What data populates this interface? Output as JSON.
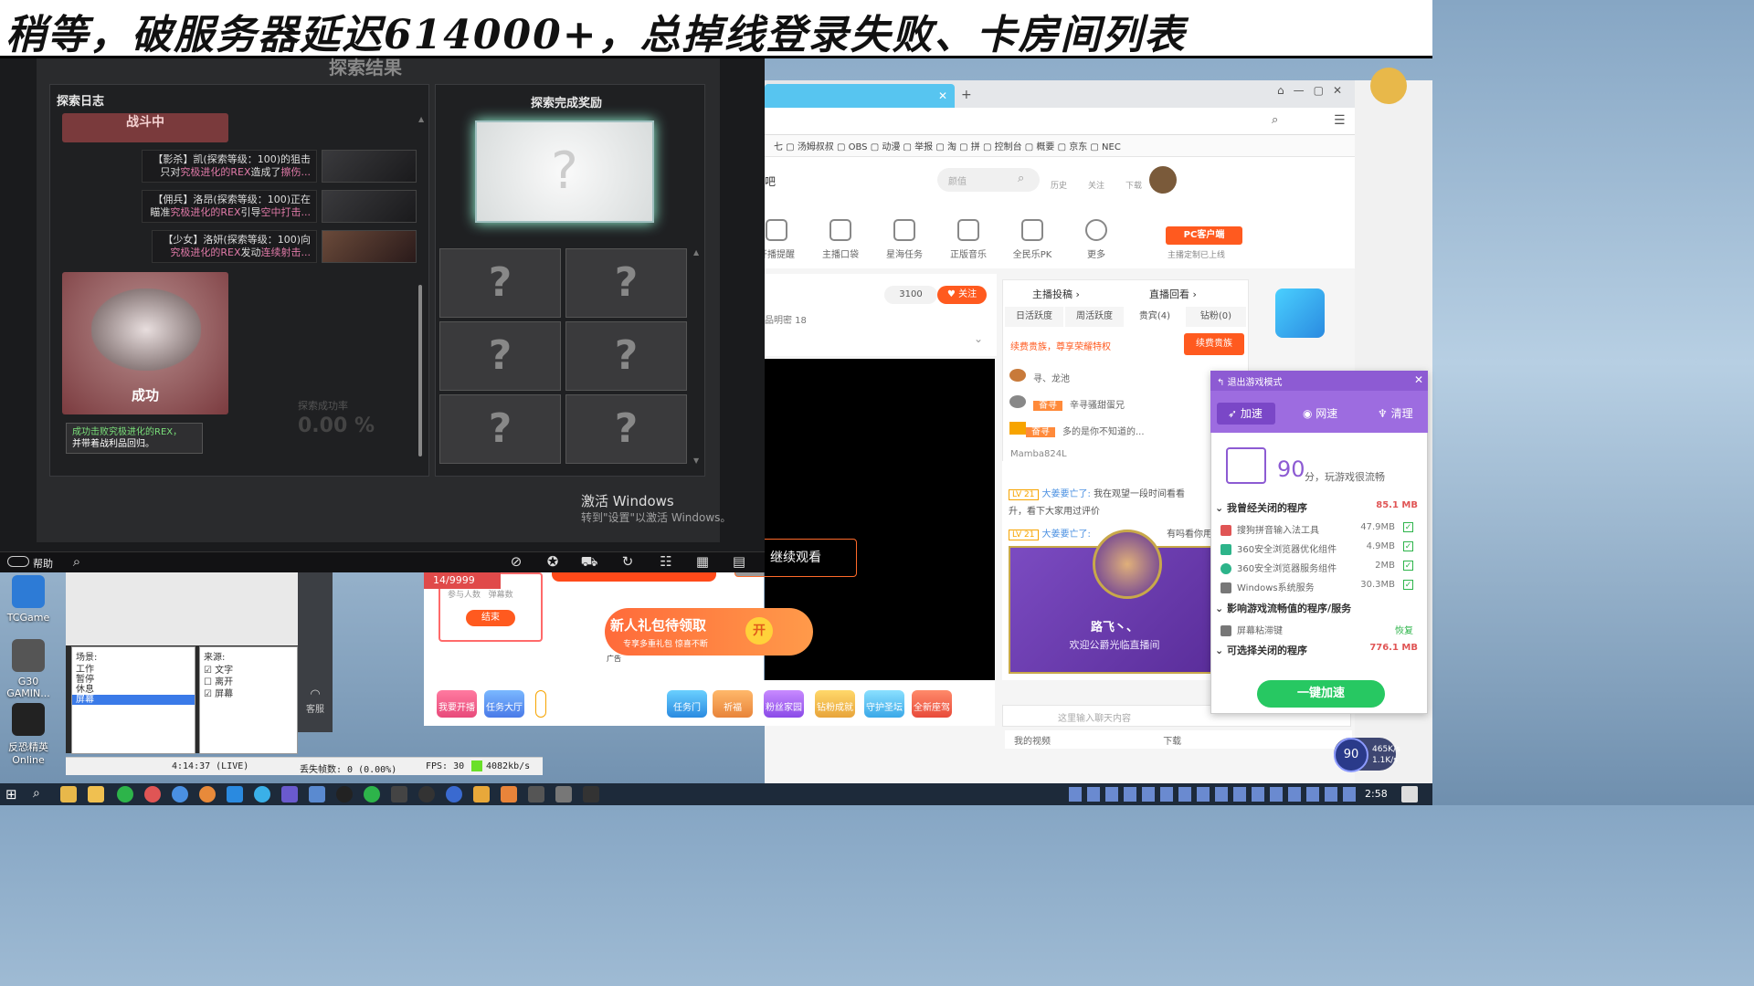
{
  "banner": {
    "text": "稍等，破服务器延迟614000+，总掉线登录失败、卡房间列表"
  },
  "desktop_icons": [
    {
      "label": "TCGame",
      "color": "#2d7bd6"
    },
    {
      "label": "G30 GAMIN...",
      "color": "#555"
    },
    {
      "label": "反恐精英 Online",
      "color": "#222"
    }
  ],
  "game": {
    "title": "探索结果",
    "log_title": "探索日志",
    "combat": "战斗中",
    "entries": [
      {
        "text1": "【影杀】凯(探索等级：100)的狙击",
        "text2": "只对",
        "hl": "究极进化的REX",
        "text3": "造成了",
        "hl2": "擦伤..."
      },
      {
        "text1": "【佣兵】洛昂(探索等级：100)正在",
        "text2": "瞄准",
        "hl": "究极进化的REX",
        "text3": "引导",
        "hl2": "空中打击..."
      },
      {
        "text1": "【少女】洛妍(探索等级：100)向",
        "text2": "",
        "hl": "究极进化的REX",
        "text3": "发动",
        "hl2": "连续射击..."
      }
    ],
    "success": "成功",
    "success_note_hl": "成功击败究极进化的REX，",
    "success_note": "并带着战利品回归。",
    "reward_title": "探索完成奖励",
    "unknown": "?",
    "rate_label": "探索成功率",
    "rate_value": "0.00 %",
    "help": "帮助",
    "watermark": "激活 Windows",
    "watermark_sub": "转到\"设置\"以激活 Windows。"
  },
  "browser": {
    "bookmarks": [
      "七",
      "汤姆叔叔",
      "OBS",
      "动漫",
      "举报",
      "淘",
      "拼",
      "控制台",
      "概要",
      "京东",
      "NEC"
    ],
    "site_label": "吧",
    "search_placeholder": "颜值",
    "head_icons": [
      "历史",
      "关注",
      "下载"
    ],
    "funcs": [
      "开播提醒",
      "主播口袋",
      "星海任务",
      "正版音乐",
      "全民乐PK",
      "更多"
    ],
    "pc_client": "PC客户端",
    "pc_sub": "主播定制已上线",
    "follow_count": "3100",
    "follow": "关注",
    "fans_label": "品明密 18",
    "continue": "继续观看",
    "rank_tabs_top": [
      "主播投稿",
      "直播回看"
    ],
    "rank_tabs": [
      "日活跃度",
      "周活跃度",
      "贵宾(4)",
      "钻粉(0)"
    ],
    "vip_text": "续费贵族，尊享荣耀特权",
    "renew": "续费贵族",
    "rank_rows": [
      "寻、龙池",
      "辛寻骚甜蛋兄",
      "多的是你不知道的..."
    ],
    "rank_badge": "奋寻",
    "rank_user": "Mamba824L",
    "chats": [
      {
        "lv": "LV 21",
        "name": "大姜要亡了:",
        "text": "我在观望一段时间看看"
      },
      {
        "lv": "",
        "name": "",
        "text": "升，看下大家用过评价"
      },
      {
        "lv": "LV 21",
        "name": "大姜要亡了:",
        "text": "有吗看你用下"
      }
    ],
    "card_name": "路飞丶、",
    "card_sub": "欢迎公爵光临直播间",
    "chat_placeholder": "这里输入聊天内容",
    "bottom_links": [
      "我的视频",
      "下载"
    ]
  },
  "booster": {
    "exit": "退出游戏模式",
    "tabs": [
      "加速",
      "网速",
      "清理"
    ],
    "score": "90",
    "score_unit": "分，玩游戏很流畅",
    "section1": {
      "title": "我曾经关闭的程序",
      "size": "85.1 MB"
    },
    "procs1": [
      {
        "name": "搜狗拼音输入法工具",
        "size": "47.9MB",
        "color": "#e05555"
      },
      {
        "name": "360安全浏览器优化组件",
        "size": "4.9MB",
        "color": "#2db48a"
      },
      {
        "name": "360安全浏览器服务组件",
        "size": "2MB",
        "color": "#2db48a"
      },
      {
        "name": "Windows系统服务",
        "size": "30.3MB",
        "color": "#777"
      }
    ],
    "section2": {
      "title": "影响游戏流畅值的程序/服务"
    },
    "proc2": {
      "name": "屏幕粘滞键",
      "action": "恢复"
    },
    "section3": {
      "title": "可选择关闭的程序",
      "size": "776.1 MB"
    },
    "one_key": "一键加速"
  },
  "obs": {
    "scenes_label": "场景:",
    "sources_label": "来源:",
    "scenes": [
      "工作",
      "暂停",
      "休息",
      "屏幕"
    ],
    "sources": [
      "文字",
      "离开",
      "屏幕"
    ],
    "status_time": "4:14:37 (LIVE)",
    "status_drop": "丢失帧数: 0 (0.00%)",
    "status_fps": "FPS: 30",
    "status_rate": "4082kb/s",
    "kefu": "客服"
  },
  "stream": {
    "count": "14/9999",
    "task_label1": "参与人数",
    "task_label2": "弹幕数",
    "end": "结束",
    "gift_title": "新人礼包待领取",
    "gift_sub": "专享多重礼包 惊喜不断",
    "gift_open": "开",
    "ad": "广告",
    "bottom_icons": [
      "我要开播",
      "任务大厅",
      "任务门",
      "祈福",
      "粉丝家园",
      "钻粉成就",
      "守护圣坛",
      "全新座驾"
    ]
  },
  "tray": {
    "time": "2:58",
    "gauge": "90",
    "up": "465K/s",
    "down": "1.1K/s"
  }
}
